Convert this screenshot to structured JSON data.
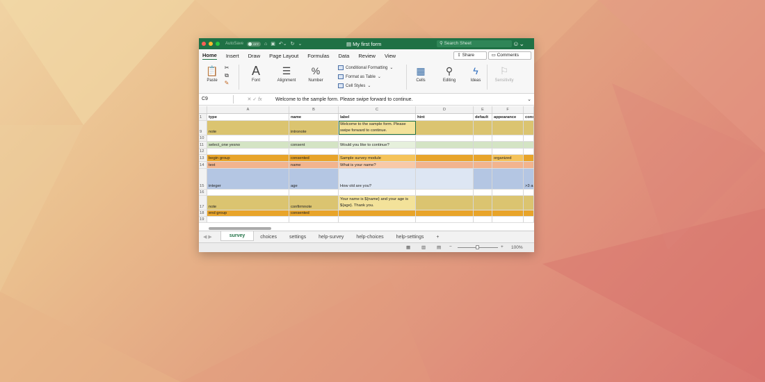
{
  "titlebar": {
    "autosave_label": "AutoSave",
    "autosave_state": "OFF",
    "doc_title": "My first form",
    "search_placeholder": "Search Sheet"
  },
  "tabs": [
    "Home",
    "Insert",
    "Draw",
    "Page Layout",
    "Formulas",
    "Data",
    "Review",
    "View"
  ],
  "share_label": "Share",
  "comments_label": "Comments",
  "ribbon": {
    "paste": "Paste",
    "font": "Font",
    "alignment": "Alignment",
    "number": "Number",
    "conditional_formatting": "Conditional Formatting",
    "format_as_table": "Format as Table",
    "cell_styles": "Cell Styles",
    "cells": "Cells",
    "editing": "Editing",
    "ideas": "Ideas",
    "sensitivity": "Sensitivity"
  },
  "formula_bar": {
    "name_box": "C9",
    "formula": "Welcome to the sample form. Please swipe forward to continue."
  },
  "columns": [
    "A",
    "B",
    "C",
    "D",
    "E",
    "F",
    ""
  ],
  "rows": [
    {
      "n": "1",
      "cells": [
        "type",
        "name",
        "label",
        "hint",
        "default",
        "appearance",
        "constrai"
      ]
    },
    {
      "n": "9",
      "cells": [
        "note",
        "intronote",
        "Welcome to the sample form. Please swipe forward to continue.",
        "",
        "",
        "",
        ""
      ]
    },
    {
      "n": "10",
      "cells": [
        "",
        "",
        "",
        "",
        "",
        "",
        ""
      ]
    },
    {
      "n": "11",
      "cells": [
        "select_one yesno",
        "consent",
        "Would you like to continue?",
        "",
        "",
        "",
        ""
      ]
    },
    {
      "n": "12",
      "cells": [
        "",
        "",
        "",
        "",
        "",
        "",
        ""
      ]
    },
    {
      "n": "13",
      "cells": [
        "begin group",
        "consented",
        "Sample survey module",
        "",
        "",
        "organized",
        ""
      ]
    },
    {
      "n": "14",
      "cells": [
        "text",
        "name",
        "What is your name?",
        "",
        "",
        "",
        ""
      ]
    },
    {
      "n": "15",
      "cells": [
        "integer",
        "age",
        "How old are you?",
        "",
        "",
        "",
        ">3 and"
      ]
    },
    {
      "n": "16",
      "cells": [
        "",
        "",
        "",
        "",
        "",
        "",
        ""
      ]
    },
    {
      "n": "17",
      "cells": [
        "note",
        "confirmnote",
        "Your name is ${name} and your age is ${age}. Thank you.",
        "",
        "",
        "",
        ""
      ]
    },
    {
      "n": "18",
      "cells": [
        "end group",
        "consented",
        "",
        "",
        "",
        "",
        ""
      ]
    },
    {
      "n": "19",
      "cells": [
        "",
        "",
        "",
        "",
        "",
        "",
        ""
      ]
    }
  ],
  "sheet_tabs": [
    "survey",
    "choices",
    "settings",
    "help-survey",
    "help-choices",
    "help-settings"
  ],
  "zoom": "100%",
  "colors": {
    "excel_green": "#1f7145",
    "note_row": "#dbc470",
    "yesno_row": "#d4e4c4",
    "group_row": "#e8a42a",
    "text_row": "#f2b48e",
    "integer_row": "#b4c6e3",
    "selected_border": "#1f7145"
  }
}
